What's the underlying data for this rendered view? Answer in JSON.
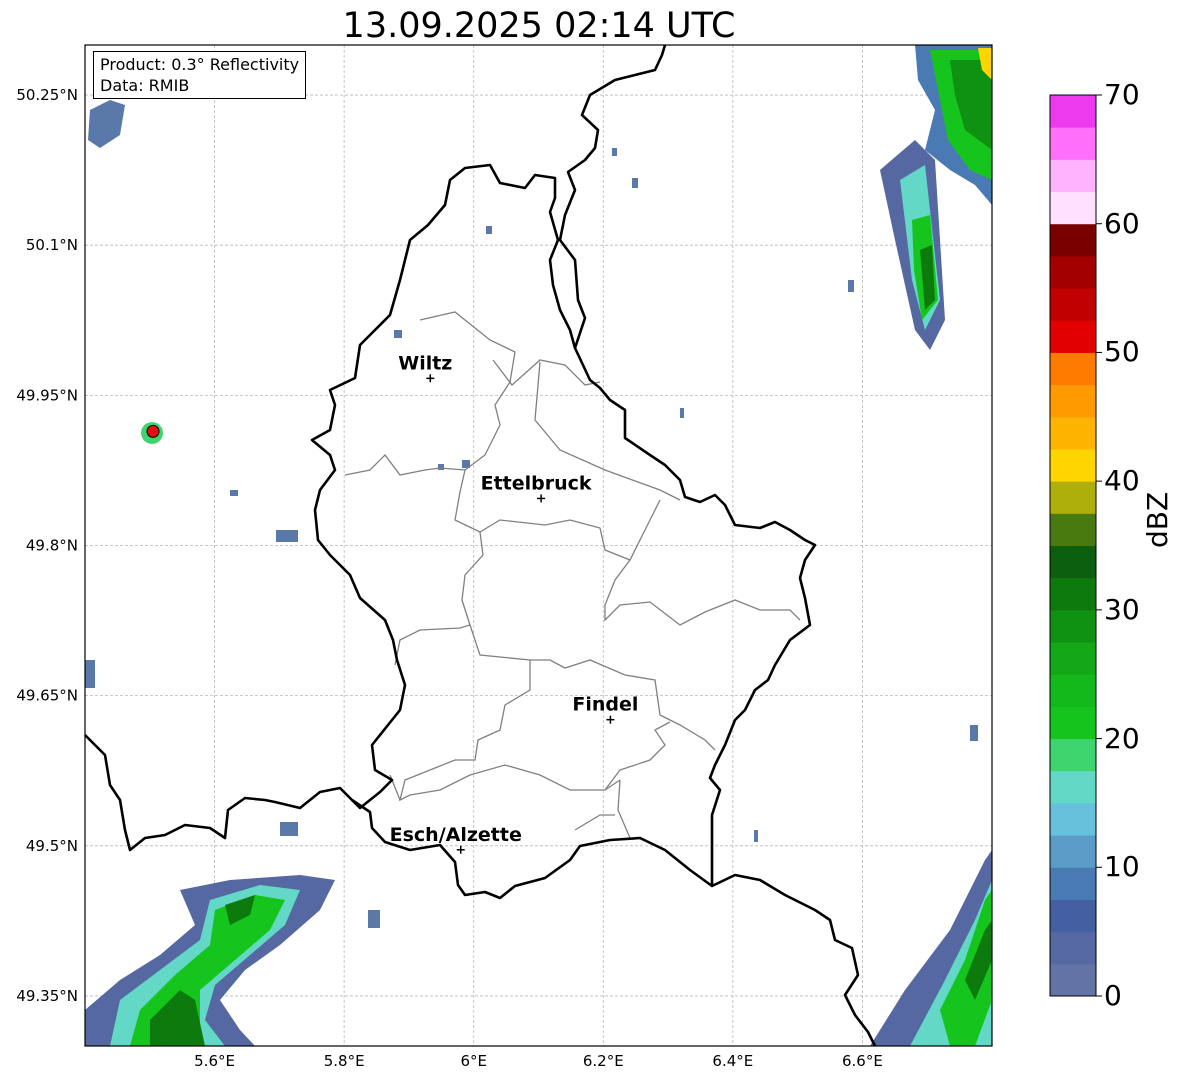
{
  "title": "13.09.2025 02:14 UTC",
  "info": {
    "product": "Product: 0.3° Reflectivity",
    "data": "Data: RMIB"
  },
  "map": {
    "lon_range": [
      5.4,
      6.8
    ],
    "lat_range": [
      49.3,
      50.3
    ],
    "lon_ticks": [
      {
        "value": 5.6,
        "label": "5.6°E"
      },
      {
        "value": 5.8,
        "label": "5.8°E"
      },
      {
        "value": 6.0,
        "label": "6°E"
      },
      {
        "value": 6.2,
        "label": "6.2°E"
      },
      {
        "value": 6.4,
        "label": "6.4°E"
      },
      {
        "value": 6.6,
        "label": "6.6°E"
      }
    ],
    "lat_ticks": [
      {
        "value": 50.25,
        "label": "50.25°N"
      },
      {
        "value": 50.1,
        "label": "50.1°N"
      },
      {
        "value": 49.95,
        "label": "49.95°N"
      },
      {
        "value": 49.8,
        "label": "49.8°N"
      },
      {
        "value": 49.65,
        "label": "49.65°N"
      },
      {
        "value": 49.5,
        "label": "49.5°N"
      },
      {
        "value": 49.35,
        "label": "49.35°N"
      }
    ],
    "grid": true,
    "cities": [
      {
        "name": "Wiltz",
        "lon": 5.933,
        "lat": 49.967
      },
      {
        "name": "Ettelbruck",
        "lon": 6.104,
        "lat": 49.847
      },
      {
        "name": "Findel",
        "lon": 6.211,
        "lat": 49.626
      },
      {
        "name": "Esch/Alzette",
        "lon": 5.98,
        "lat": 49.496
      }
    ],
    "radar_site": {
      "lon": 5.505,
      "lat": 49.914,
      "color": "#e01010"
    }
  },
  "colorbar": {
    "label": "dBZ",
    "min": 0,
    "max": 70,
    "ticks": [
      {
        "value": 70,
        "label": "70"
      },
      {
        "value": 60,
        "label": "60"
      },
      {
        "value": 50,
        "label": "50"
      },
      {
        "value": 40,
        "label": "40"
      },
      {
        "value": 30,
        "label": "30"
      },
      {
        "value": 20,
        "label": "20"
      },
      {
        "value": 10,
        "label": "10"
      },
      {
        "value": 0,
        "label": "0"
      }
    ],
    "colors": [
      "#6373a6",
      "#5568a1",
      "#4560a1",
      "#4a7ab3",
      "#5a9bc7",
      "#66c1dc",
      "#63d8c6",
      "#3ed56f",
      "#15c51d",
      "#13b81a",
      "#12a816",
      "#0f9111",
      "#0c7a0d",
      "#0d5f10",
      "#497a0f",
      "#aeb00a",
      "#ffd500",
      "#ffb500",
      "#ff9a00",
      "#ff7b00",
      "#e20000",
      "#c10000",
      "#a30000",
      "#7a0000",
      "#ffe1ff",
      "#ffb3ff",
      "#ff6ffa",
      "#ee3aee"
    ]
  }
}
